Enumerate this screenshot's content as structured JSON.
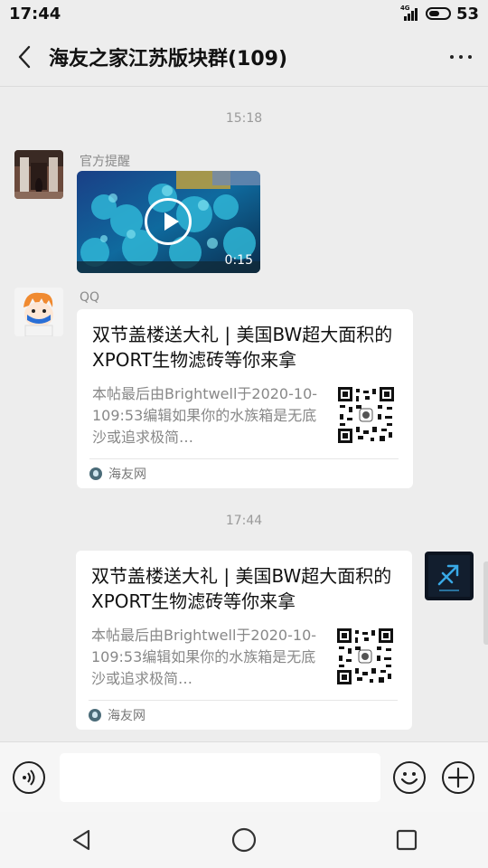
{
  "status_bar": {
    "time": "17:44",
    "network": "4G",
    "battery": "53",
    "battery_level": 0.53
  },
  "header": {
    "title": "海友之家江苏版块群(109)"
  },
  "messages": {
    "time_1": "15:18",
    "msg1_sender": "官方提醒",
    "msg1_video_duration": "0:15",
    "msg2_sender": "QQ",
    "time_2": "17:44"
  },
  "cards": [
    {
      "title": "双节盖楼送大礼 | 美国BW超大面积的XPORT生物滤砖等你来拿",
      "desc": "本帖最后由Brightwell于2020-10-109:53编辑如果你的水族箱是无底沙或追求极简…",
      "source": "海友网"
    },
    {
      "title": "双节盖楼送大礼 | 美国BW超大面积的XPORT生物滤砖等你来拿",
      "desc": "本帖最后由Brightwell于2020-10-109:53编辑如果你的水族箱是无底沙或追求极简…",
      "source": "海友网"
    }
  ],
  "input": {
    "value": ""
  },
  "icons": {
    "voice": "voice-icon",
    "emoji": "emoji-icon",
    "add": "plus-icon",
    "nav_back": "triangle-back-icon",
    "nav_home": "circle-home-icon",
    "nav_recents": "square-recents-icon"
  },
  "colors": {
    "background": "#ededed",
    "card": "#ffffff",
    "muted_text": "#888888",
    "input_bar": "#f6f6f6"
  }
}
